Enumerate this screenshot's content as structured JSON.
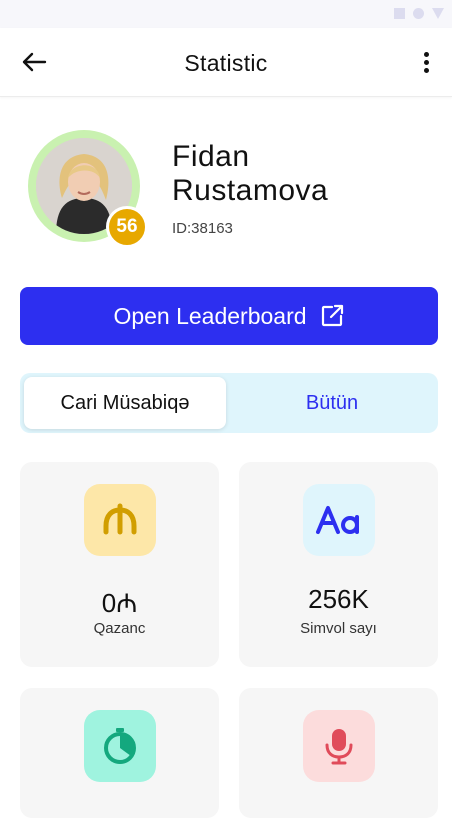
{
  "app_bar": {
    "title": "Statistic"
  },
  "profile": {
    "first_name": "Fidan",
    "last_name": "Rustamova",
    "id_text": "ID:38163",
    "level": "56"
  },
  "leaderboard_button": {
    "label": "Open Leaderboard"
  },
  "tabs": [
    {
      "label": "Cari Müsabiqə",
      "active": true
    },
    {
      "label": "Bütün",
      "active": false
    }
  ],
  "stats": [
    {
      "value": "0₼",
      "label": "Qazanc",
      "icon": "manat-icon",
      "icon_bg": "#fde7a8",
      "icon_color": "#d19e00"
    },
    {
      "value": "256K",
      "label": "Simvol sayı",
      "icon": "text-aa-icon",
      "icon_bg": "#dff5fc",
      "icon_color": "#2d2ff0"
    },
    {
      "icon": "stopwatch-icon",
      "icon_bg": "#9ff3df",
      "icon_color": "#14a87e"
    },
    {
      "icon": "microphone-icon",
      "icon_bg": "#fcdcdc",
      "icon_color": "#e04b5a"
    }
  ],
  "colors": {
    "primary": "#2d2ff0",
    "badge": "#e7a800",
    "avatar_ring": "#c9f1b0",
    "segment_bg": "#dff5fc"
  }
}
